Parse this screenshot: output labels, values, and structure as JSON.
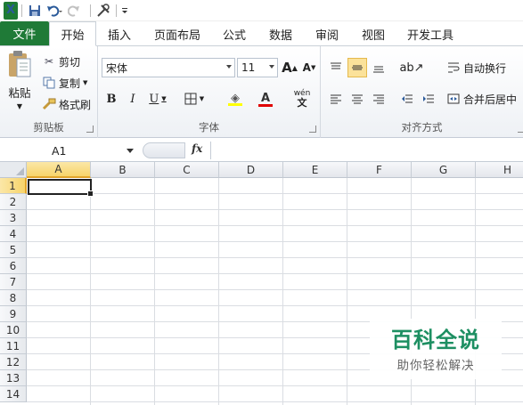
{
  "qat": {
    "app_logo": "X",
    "icons": [
      "save-icon",
      "undo-icon",
      "redo-icon",
      "format-tools-icon",
      "customize-qat-icon"
    ]
  },
  "tabs": [
    "文件",
    "开始",
    "插入",
    "页面布局",
    "公式",
    "数据",
    "审阅",
    "视图",
    "开发工具"
  ],
  "ribbon": {
    "clipboard": {
      "title": "剪贴板",
      "paste": "粘贴",
      "cut": "剪切",
      "copy": "复制",
      "format_painter": "格式刷"
    },
    "font": {
      "title": "字体",
      "font_name": "宋体",
      "font_size": "11",
      "increase_size": "A",
      "decrease_size": "A",
      "bold": "B",
      "italic": "I",
      "underline": "U",
      "font_color_letter": "A",
      "phonetic": "wén"
    },
    "alignment": {
      "title": "对齐方式",
      "wrap_text": "自动换行",
      "merge_center": "合并后居中"
    }
  },
  "formula_bar": {
    "name_box": "A1",
    "fx_label": "fx",
    "formula_value": ""
  },
  "grid": {
    "columns": [
      "A",
      "B",
      "C",
      "D",
      "E",
      "F",
      "G",
      "H"
    ],
    "rows": [
      "1",
      "2",
      "3",
      "4",
      "5",
      "6",
      "7",
      "8",
      "9",
      "10",
      "11",
      "12",
      "13",
      "14"
    ],
    "active_cell": "A1"
  },
  "watermark": {
    "title": "百科全说",
    "subtitle": "助你轻松解决"
  },
  "colors": {
    "file_tab": "#1f7a37",
    "selected_header": "#f7d46a",
    "watermark_green": "#1d8f62"
  }
}
